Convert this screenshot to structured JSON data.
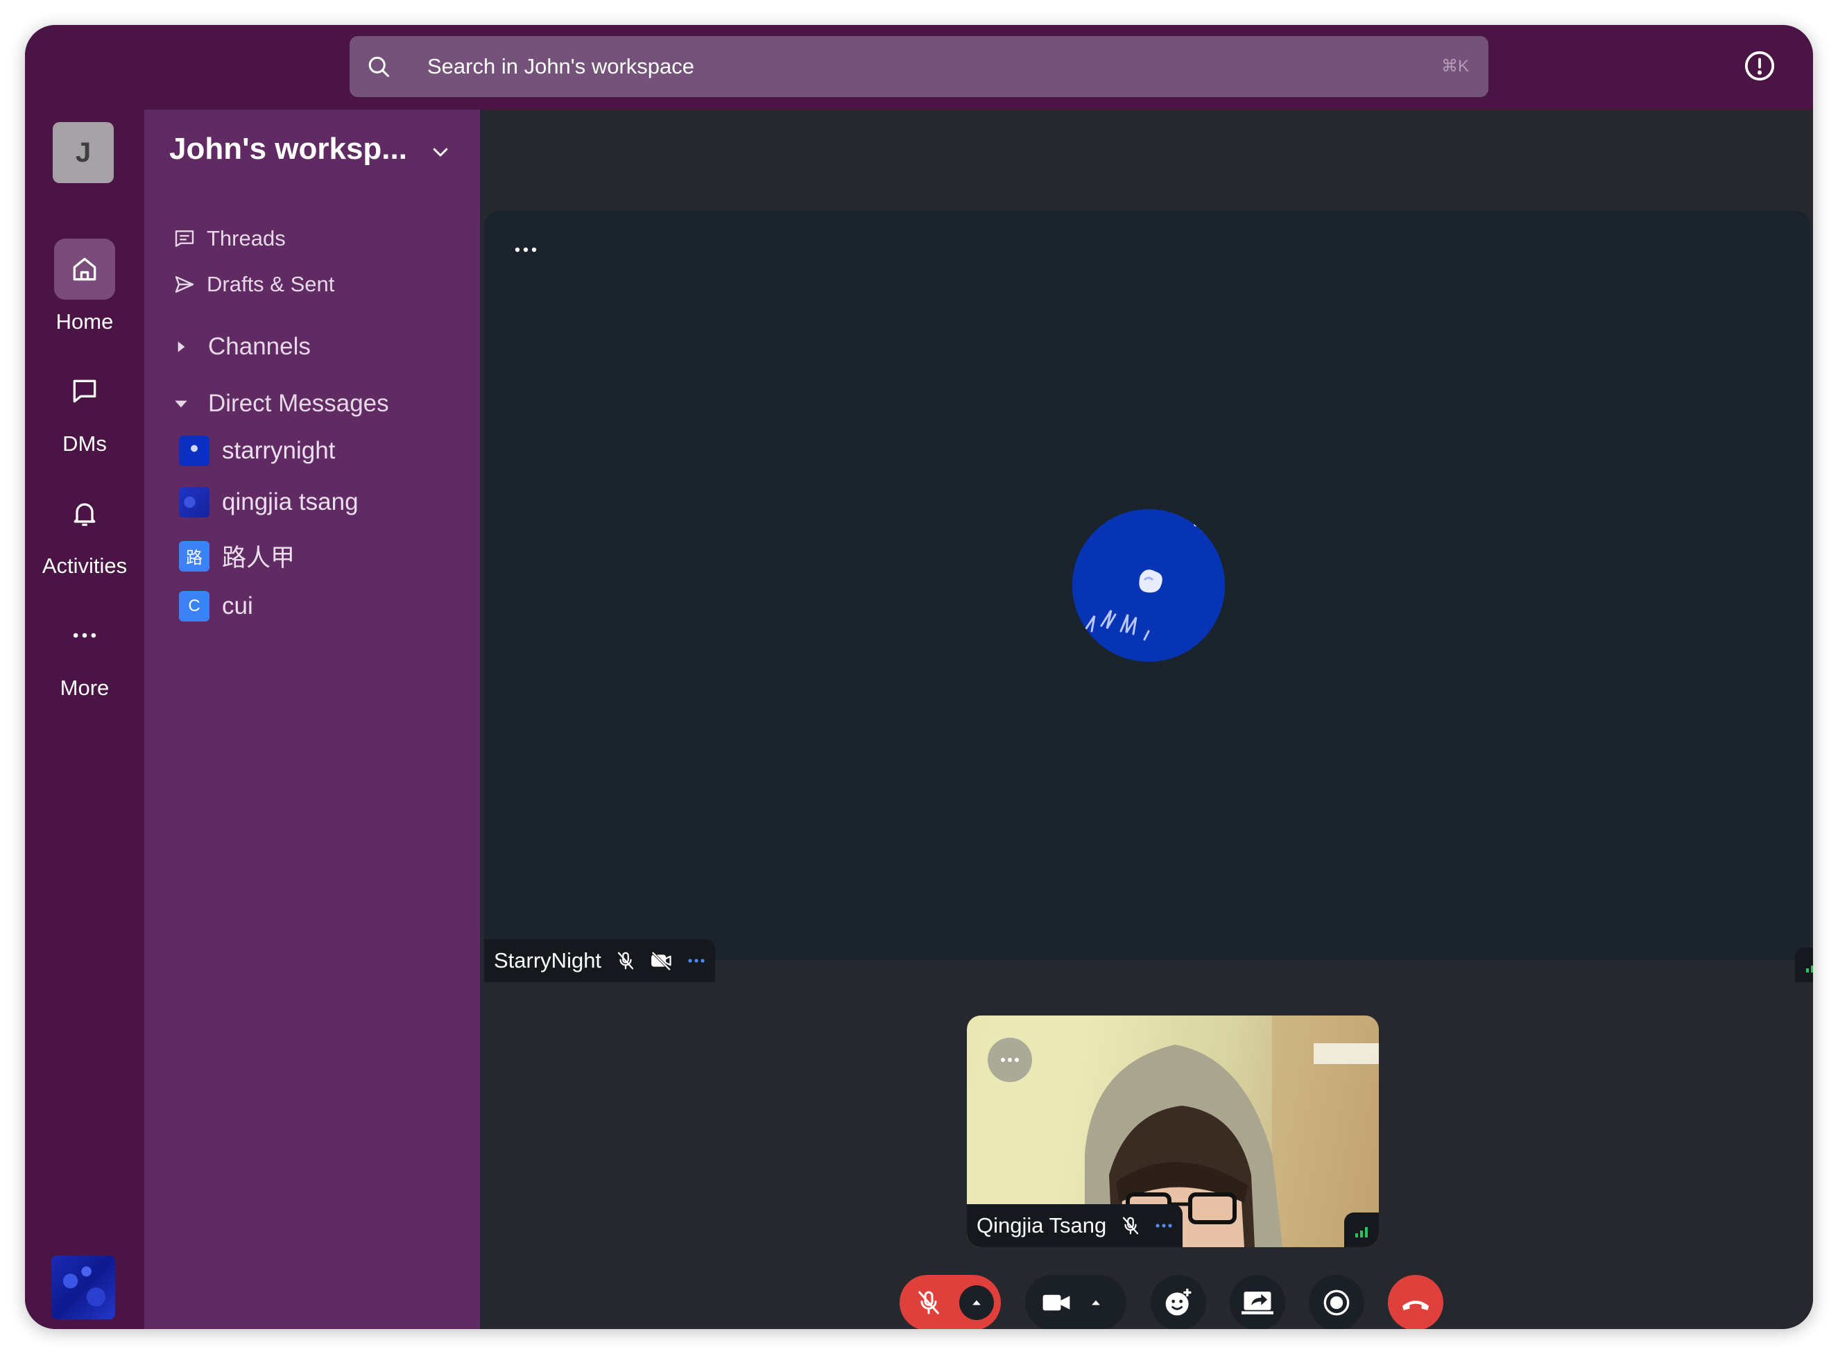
{
  "search": {
    "placeholder": "Search in John's workspace",
    "shortcut": "⌘K"
  },
  "rail": {
    "workspace_initial": "J",
    "items": [
      {
        "label": "Home",
        "icon": "home-icon",
        "active": true
      },
      {
        "label": "DMs",
        "icon": "chat-icon",
        "active": false
      },
      {
        "label": "Activities",
        "icon": "bell-icon",
        "active": false
      },
      {
        "label": "More",
        "icon": "more-icon",
        "active": false
      }
    ]
  },
  "sidebar": {
    "workspace_name": "John's worksp...",
    "links": [
      {
        "label": "Threads",
        "icon": "threads-icon"
      },
      {
        "label": "Drafts & Sent",
        "icon": "send-icon"
      }
    ],
    "channels_label": "Channels",
    "dms_label": "Direct Messages",
    "dms": [
      {
        "name": "starrynight",
        "avatar": ""
      },
      {
        "name": "qingjia tsang",
        "avatar": ""
      },
      {
        "name": "路人甲",
        "avatar": "路"
      },
      {
        "name": "cui",
        "avatar": "C"
      }
    ]
  },
  "call": {
    "main_participant": "StarryNight",
    "tile_participant": "Qingjia Tsang"
  },
  "colors": {
    "frame": "#4a1545",
    "sidebar": "#5f2b62",
    "stage": "#1b232d",
    "danger": "#e0403c",
    "signal": "#22c55e"
  }
}
